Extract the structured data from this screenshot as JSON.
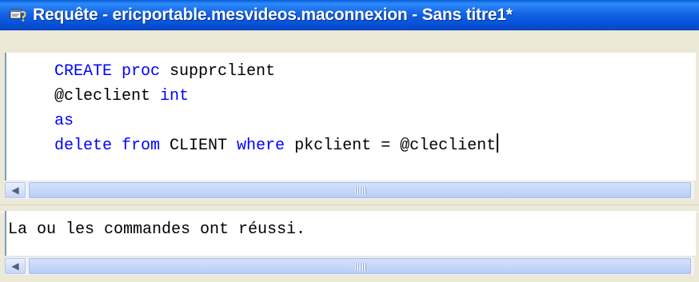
{
  "window": {
    "title": "Requête - ericportable.mesvideos.maconnexion - Sans titre1*",
    "icon": "query-window-icon"
  },
  "editor": {
    "lines": [
      {
        "parts": [
          {
            "text": "CREATE proc",
            "kw": true
          },
          {
            "text": " supprclient",
            "kw": false
          }
        ]
      },
      {
        "parts": [
          {
            "text": "@cleclient ",
            "kw": false
          },
          {
            "text": "int",
            "kw": true
          }
        ]
      },
      {
        "parts": [
          {
            "text": "as",
            "kw": true
          }
        ]
      },
      {
        "parts": [
          {
            "text": "delete from",
            "kw": true
          },
          {
            "text": " CLIENT ",
            "kw": false
          },
          {
            "text": "where",
            "kw": true
          },
          {
            "text": " pkclient = @cleclient",
            "kw": false
          }
        ]
      }
    ],
    "colors": {
      "keyword": "#0000FF",
      "text": "#000000"
    }
  },
  "results": {
    "message": "La ou les commandes ont réussi."
  },
  "scrollbars": {
    "left_arrow_icon": "chevron-left-icon",
    "grip_icon": "scroll-grip-icon"
  }
}
